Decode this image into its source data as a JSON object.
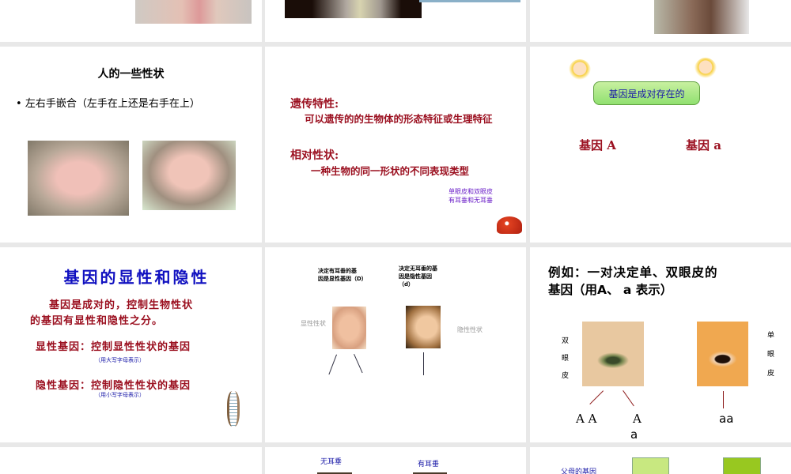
{
  "slides": [
    {
      "id": 1
    },
    {
      "id": 2
    },
    {
      "id": 3
    },
    {
      "id": 4,
      "title": "人的一些性状",
      "bullet": "左右手嵌合（左手在上还是右手在上）"
    },
    {
      "id": 5,
      "heading1": "遗传特性:",
      "text1": "可以遗传的的生物体的形态特征或生理特征",
      "heading2": "相对性状:",
      "text2": "一种生物的同一形状的不同表现类型",
      "note1": "单眼皮和双眼皮",
      "note2": "有耳垂和无耳垂"
    },
    {
      "id": 6,
      "banner": "基因是成对存在的",
      "geneA": "基因 A",
      "genea": "基因 a"
    },
    {
      "id": 7,
      "title": "基因的显性和隐性",
      "para1": "基因是成对的，控制生物性状",
      "para2": "的基因有显性和隐性之分。",
      "dominant": "显性基因：控制显性性状的基因",
      "dominant_note": "（用大写字母表示）",
      "recessive": "隐性基因：控制隐性性状的基因",
      "recessive_note": "（用小写字母表示）"
    },
    {
      "id": 8,
      "label_d1": "决定有耳垂的基",
      "label_d2": "因是显性基因（D）",
      "label_r1": "决定无耳垂的基",
      "label_r2": "因是隐性基因",
      "label_r3": "（d）",
      "dominant_trait": "显性性状",
      "recessive_trait": "隐性性状"
    },
    {
      "id": 9,
      "title1": "例如：一对决定单、双眼皮的",
      "title2": "基因（用A、 a 表示）",
      "double_lid": [
        "双",
        "眼",
        "皮"
      ],
      "single_lid": [
        "单",
        "眼",
        "皮"
      ],
      "AA": "A A",
      "Aa_top": "A",
      "Aa_bottom": "a",
      "aa": "aa"
    },
    {
      "id": 10
    },
    {
      "id": 11,
      "no_lobe": "无耳垂",
      "has_lobe": "有耳垂"
    },
    {
      "id": 12,
      "parents_genes": "父母的基因"
    }
  ]
}
